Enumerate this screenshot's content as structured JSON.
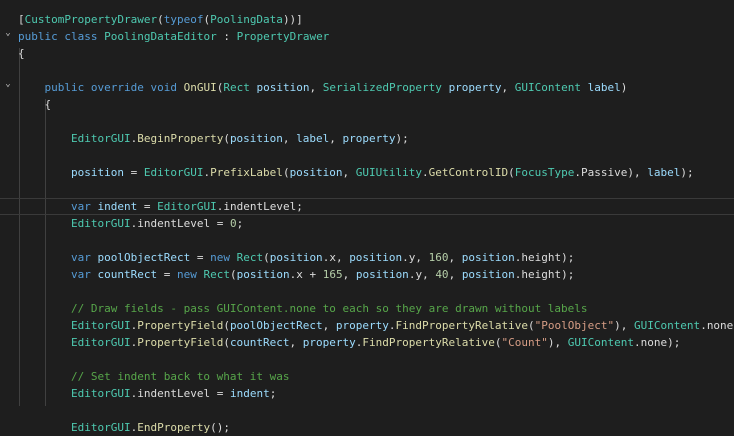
{
  "theme": {
    "background": "#1e1e1e",
    "keyword": "#569cd6",
    "type": "#4ec9b0",
    "method": "#dcdcaa",
    "parameter": "#9cdcfe",
    "string": "#d69d85",
    "number": "#b5cea8",
    "comment": "#57a64a"
  },
  "fold_markers": {
    "class": "⌄",
    "method": "⌄"
  },
  "lines": [
    [
      [
        "pu",
        "["
      ],
      [
        "ty",
        "CustomPropertyDrawer"
      ],
      [
        "pu",
        "("
      ],
      [
        "kw",
        "typeof"
      ],
      [
        "pu",
        "("
      ],
      [
        "ty",
        "PoolingData"
      ],
      [
        "pu",
        "))]"
      ]
    ],
    [
      [
        "kw",
        "public"
      ],
      [
        "ws",
        " "
      ],
      [
        "kw",
        "class"
      ],
      [
        "ws",
        " "
      ],
      [
        "ty",
        "PoolingDataEditor"
      ],
      [
        "ws",
        " "
      ],
      [
        "pu",
        ":"
      ],
      [
        "ws",
        " "
      ],
      [
        "ty",
        "PropertyDrawer"
      ]
    ],
    [
      [
        "pu",
        "{"
      ]
    ],
    [],
    [
      [
        "ws",
        "    "
      ],
      [
        "kw",
        "public"
      ],
      [
        "ws",
        " "
      ],
      [
        "kw",
        "override"
      ],
      [
        "ws",
        " "
      ],
      [
        "kw",
        "void"
      ],
      [
        "ws",
        " "
      ],
      [
        "fn",
        "OnGUI"
      ],
      [
        "pu",
        "("
      ],
      [
        "ty",
        "Rect"
      ],
      [
        "ws",
        " "
      ],
      [
        "pr",
        "position"
      ],
      [
        "pu",
        ","
      ],
      [
        "ws",
        " "
      ],
      [
        "ty",
        "SerializedProperty"
      ],
      [
        "ws",
        " "
      ],
      [
        "pr",
        "property"
      ],
      [
        "pu",
        ","
      ],
      [
        "ws",
        " "
      ],
      [
        "ty",
        "GUIContent"
      ],
      [
        "ws",
        " "
      ],
      [
        "pr",
        "label"
      ],
      [
        "pu",
        ")"
      ]
    ],
    [
      [
        "ws",
        "    "
      ],
      [
        "pu",
        "{"
      ]
    ],
    [],
    [
      [
        "ws",
        "        "
      ],
      [
        "ty",
        "EditorGUI"
      ],
      [
        "pu",
        "."
      ],
      [
        "fn",
        "BeginProperty"
      ],
      [
        "pu",
        "("
      ],
      [
        "pr",
        "position"
      ],
      [
        "pu",
        ","
      ],
      [
        "ws",
        " "
      ],
      [
        "pr",
        "label"
      ],
      [
        "pu",
        ","
      ],
      [
        "ws",
        " "
      ],
      [
        "pr",
        "property"
      ],
      [
        "pu",
        ");"
      ]
    ],
    [],
    [
      [
        "ws",
        "        "
      ],
      [
        "pr",
        "position"
      ],
      [
        "ws",
        " "
      ],
      [
        "pu",
        "="
      ],
      [
        "ws",
        " "
      ],
      [
        "ty",
        "EditorGUI"
      ],
      [
        "pu",
        "."
      ],
      [
        "fn",
        "PrefixLabel"
      ],
      [
        "pu",
        "("
      ],
      [
        "pr",
        "position"
      ],
      [
        "pu",
        ","
      ],
      [
        "ws",
        " "
      ],
      [
        "ty",
        "GUIUtility"
      ],
      [
        "pu",
        "."
      ],
      [
        "fn",
        "GetControlID"
      ],
      [
        "pu",
        "("
      ],
      [
        "ty",
        "FocusType"
      ],
      [
        "pu",
        "."
      ],
      [
        "id",
        "Passive"
      ],
      [
        "pu",
        "),"
      ],
      [
        "ws",
        " "
      ],
      [
        "pr",
        "label"
      ],
      [
        "pu",
        ");"
      ]
    ],
    [],
    [
      [
        "ws",
        "        "
      ],
      [
        "kw",
        "var"
      ],
      [
        "ws",
        " "
      ],
      [
        "pr",
        "indent"
      ],
      [
        "ws",
        " "
      ],
      [
        "pu",
        "="
      ],
      [
        "ws",
        " "
      ],
      [
        "ty",
        "EditorGUI"
      ],
      [
        "pu",
        "."
      ],
      [
        "id",
        "indentLevel"
      ],
      [
        "pu",
        ";"
      ]
    ],
    [
      [
        "ws",
        "        "
      ],
      [
        "ty",
        "EditorGUI"
      ],
      [
        "pu",
        "."
      ],
      [
        "id",
        "indentLevel"
      ],
      [
        "ws",
        " "
      ],
      [
        "pu",
        "="
      ],
      [
        "ws",
        " "
      ],
      [
        "nu",
        "0"
      ],
      [
        "pu",
        ";"
      ]
    ],
    [],
    [
      [
        "ws",
        "        "
      ],
      [
        "kw",
        "var"
      ],
      [
        "ws",
        " "
      ],
      [
        "pr",
        "poolObjectRect"
      ],
      [
        "ws",
        " "
      ],
      [
        "pu",
        "="
      ],
      [
        "ws",
        " "
      ],
      [
        "kw",
        "new"
      ],
      [
        "ws",
        " "
      ],
      [
        "ty",
        "Rect"
      ],
      [
        "pu",
        "("
      ],
      [
        "pr",
        "position"
      ],
      [
        "pu",
        "."
      ],
      [
        "id",
        "x"
      ],
      [
        "pu",
        ","
      ],
      [
        "ws",
        " "
      ],
      [
        "pr",
        "position"
      ],
      [
        "pu",
        "."
      ],
      [
        "id",
        "y"
      ],
      [
        "pu",
        ","
      ],
      [
        "ws",
        " "
      ],
      [
        "nu",
        "160"
      ],
      [
        "pu",
        ","
      ],
      [
        "ws",
        " "
      ],
      [
        "pr",
        "position"
      ],
      [
        "pu",
        "."
      ],
      [
        "id",
        "height"
      ],
      [
        "pu",
        ");"
      ]
    ],
    [
      [
        "ws",
        "        "
      ],
      [
        "kw",
        "var"
      ],
      [
        "ws",
        " "
      ],
      [
        "pr",
        "countRect"
      ],
      [
        "ws",
        " "
      ],
      [
        "pu",
        "="
      ],
      [
        "ws",
        " "
      ],
      [
        "kw",
        "new"
      ],
      [
        "ws",
        " "
      ],
      [
        "ty",
        "Rect"
      ],
      [
        "pu",
        "("
      ],
      [
        "pr",
        "position"
      ],
      [
        "pu",
        "."
      ],
      [
        "id",
        "x"
      ],
      [
        "ws",
        " "
      ],
      [
        "pu",
        "+"
      ],
      [
        "ws",
        " "
      ],
      [
        "nu",
        "165"
      ],
      [
        "pu",
        ","
      ],
      [
        "ws",
        " "
      ],
      [
        "pr",
        "position"
      ],
      [
        "pu",
        "."
      ],
      [
        "id",
        "y"
      ],
      [
        "pu",
        ","
      ],
      [
        "ws",
        " "
      ],
      [
        "nu",
        "40"
      ],
      [
        "pu",
        ","
      ],
      [
        "ws",
        " "
      ],
      [
        "pr",
        "position"
      ],
      [
        "pu",
        "."
      ],
      [
        "id",
        "height"
      ],
      [
        "pu",
        ");"
      ]
    ],
    [],
    [
      [
        "ws",
        "        "
      ],
      [
        "cm",
        "// Draw fields - pass GUIContent.none to each so they are drawn without labels"
      ]
    ],
    [
      [
        "ws",
        "        "
      ],
      [
        "ty",
        "EditorGUI"
      ],
      [
        "pu",
        "."
      ],
      [
        "fn",
        "PropertyField"
      ],
      [
        "pu",
        "("
      ],
      [
        "pr",
        "poolObjectRect"
      ],
      [
        "pu",
        ","
      ],
      [
        "ws",
        " "
      ],
      [
        "pr",
        "property"
      ],
      [
        "pu",
        "."
      ],
      [
        "fn",
        "FindPropertyRelative"
      ],
      [
        "pu",
        "("
      ],
      [
        "st",
        "\"PoolObject\""
      ],
      [
        "pu",
        "),"
      ],
      [
        "ws",
        " "
      ],
      [
        "ty",
        "GUIContent"
      ],
      [
        "pu",
        "."
      ],
      [
        "id",
        "none"
      ],
      [
        "pu",
        ");"
      ]
    ],
    [
      [
        "ws",
        "        "
      ],
      [
        "ty",
        "EditorGUI"
      ],
      [
        "pu",
        "."
      ],
      [
        "fn",
        "PropertyField"
      ],
      [
        "pu",
        "("
      ],
      [
        "pr",
        "countRect"
      ],
      [
        "pu",
        ","
      ],
      [
        "ws",
        " "
      ],
      [
        "pr",
        "property"
      ],
      [
        "pu",
        "."
      ],
      [
        "fn",
        "FindPropertyRelative"
      ],
      [
        "pu",
        "("
      ],
      [
        "st",
        "\"Count\""
      ],
      [
        "pu",
        "),"
      ],
      [
        "ws",
        " "
      ],
      [
        "ty",
        "GUIContent"
      ],
      [
        "pu",
        "."
      ],
      [
        "id",
        "none"
      ],
      [
        "pu",
        ");"
      ]
    ],
    [],
    [
      [
        "ws",
        "        "
      ],
      [
        "cm",
        "// Set indent back to what it was"
      ]
    ],
    [
      [
        "ws",
        "        "
      ],
      [
        "ty",
        "EditorGUI"
      ],
      [
        "pu",
        "."
      ],
      [
        "id",
        "indentLevel"
      ],
      [
        "ws",
        " "
      ],
      [
        "pu",
        "="
      ],
      [
        "ws",
        " "
      ],
      [
        "pr",
        "indent"
      ],
      [
        "pu",
        ";"
      ]
    ],
    [],
    [
      [
        "ws",
        "        "
      ],
      [
        "ty",
        "EditorGUI"
      ],
      [
        "pu",
        "."
      ],
      [
        "fn",
        "EndProperty"
      ],
      [
        "pu",
        "();"
      ]
    ]
  ]
}
